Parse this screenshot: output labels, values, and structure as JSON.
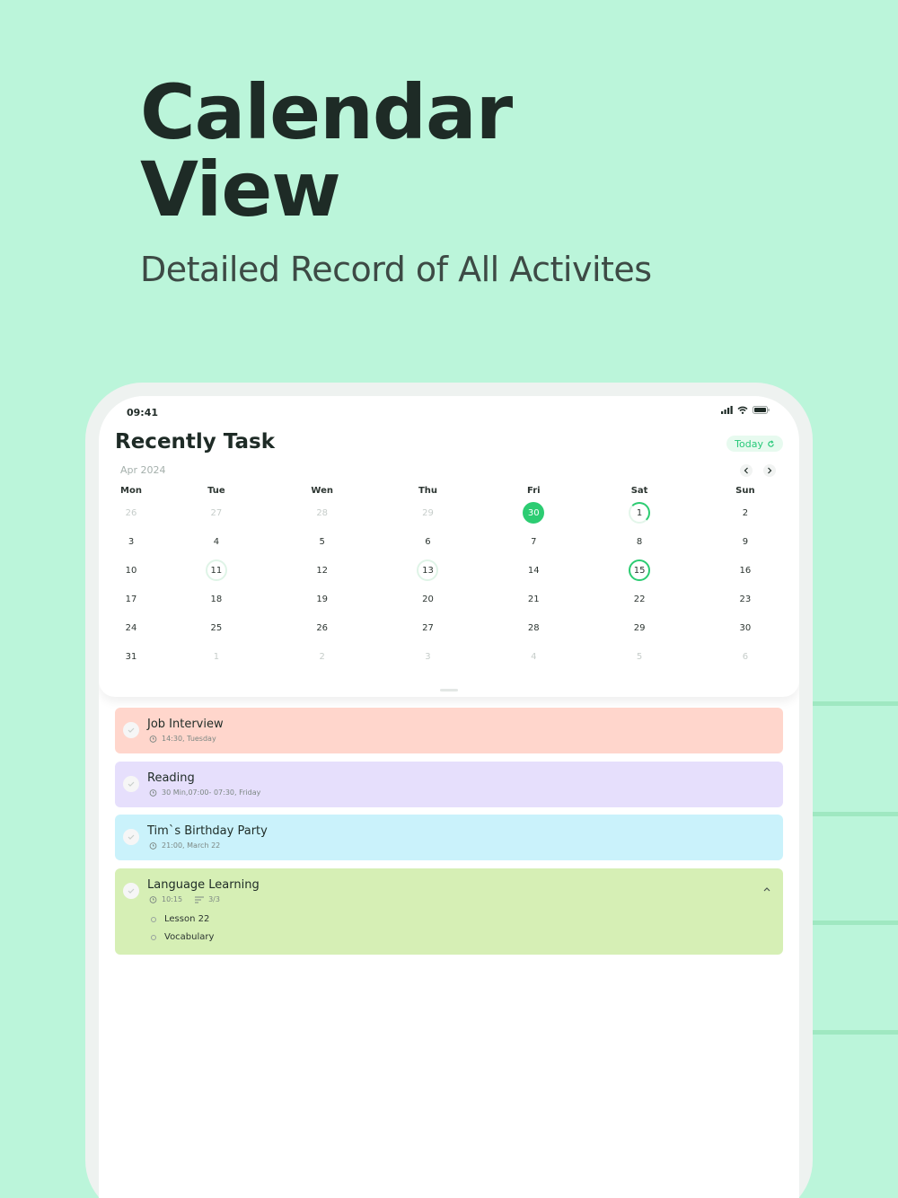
{
  "hero": {
    "title_line1": "Calendar",
    "title_line2": "View",
    "subtitle": "Detailed Record of All Activites"
  },
  "status_bar": {
    "time": "09:41"
  },
  "header": {
    "title": "Recently Task",
    "today_label": "Today"
  },
  "calendar": {
    "month_label": "Apr 2024",
    "weekdays": [
      "Mon",
      "Tue",
      "Wen",
      "Thu",
      "Fri",
      "Sat",
      "Sun"
    ],
    "weeks": [
      [
        {
          "d": "26",
          "m": true
        },
        {
          "d": "27",
          "m": true
        },
        {
          "d": "28",
          "m": true
        },
        {
          "d": "29",
          "m": true
        },
        {
          "d": "30",
          "s": "filled"
        },
        {
          "d": "1",
          "s": "ring-half"
        },
        {
          "d": "2"
        }
      ],
      [
        {
          "d": "3"
        },
        {
          "d": "4"
        },
        {
          "d": "5"
        },
        {
          "d": "6"
        },
        {
          "d": "7"
        },
        {
          "d": "8"
        },
        {
          "d": "9"
        }
      ],
      [
        {
          "d": "10"
        },
        {
          "d": "11",
          "s": "ring-light"
        },
        {
          "d": "12"
        },
        {
          "d": "13",
          "s": "ring-light"
        },
        {
          "d": "14"
        },
        {
          "d": "15",
          "s": "ring-strong"
        },
        {
          "d": "16"
        }
      ],
      [
        {
          "d": "17"
        },
        {
          "d": "18"
        },
        {
          "d": "19"
        },
        {
          "d": "20"
        },
        {
          "d": "21"
        },
        {
          "d": "22"
        },
        {
          "d": "23"
        }
      ],
      [
        {
          "d": "24"
        },
        {
          "d": "25"
        },
        {
          "d": "26"
        },
        {
          "d": "27"
        },
        {
          "d": "28"
        },
        {
          "d": "29"
        },
        {
          "d": "30"
        }
      ],
      [
        {
          "d": "31"
        },
        {
          "d": "1",
          "m": true
        },
        {
          "d": "2",
          "m": true
        },
        {
          "d": "3",
          "m": true
        },
        {
          "d": "4",
          "m": true
        },
        {
          "d": "5",
          "m": true
        },
        {
          "d": "6",
          "m": true
        }
      ]
    ]
  },
  "tasks": [
    {
      "title": "Job Interview",
      "meta": "14:30, Tuesday",
      "color": "#ffd6cc"
    },
    {
      "title": "Reading",
      "meta": "30 Min,07:00- 07:30, Friday",
      "color": "#e6dffc"
    },
    {
      "title": "Tim`s Birthday Party",
      "meta": "21:00, March 22",
      "color": "#caf2fb"
    },
    {
      "title": "Language Learning",
      "meta": "10:15",
      "progress": "3/3",
      "color": "#d6efb5",
      "subtasks": [
        "Lesson 22",
        "Vocabulary"
      ]
    }
  ],
  "colors": {
    "accent": "#2ccc72",
    "background": "#bbf5da"
  }
}
